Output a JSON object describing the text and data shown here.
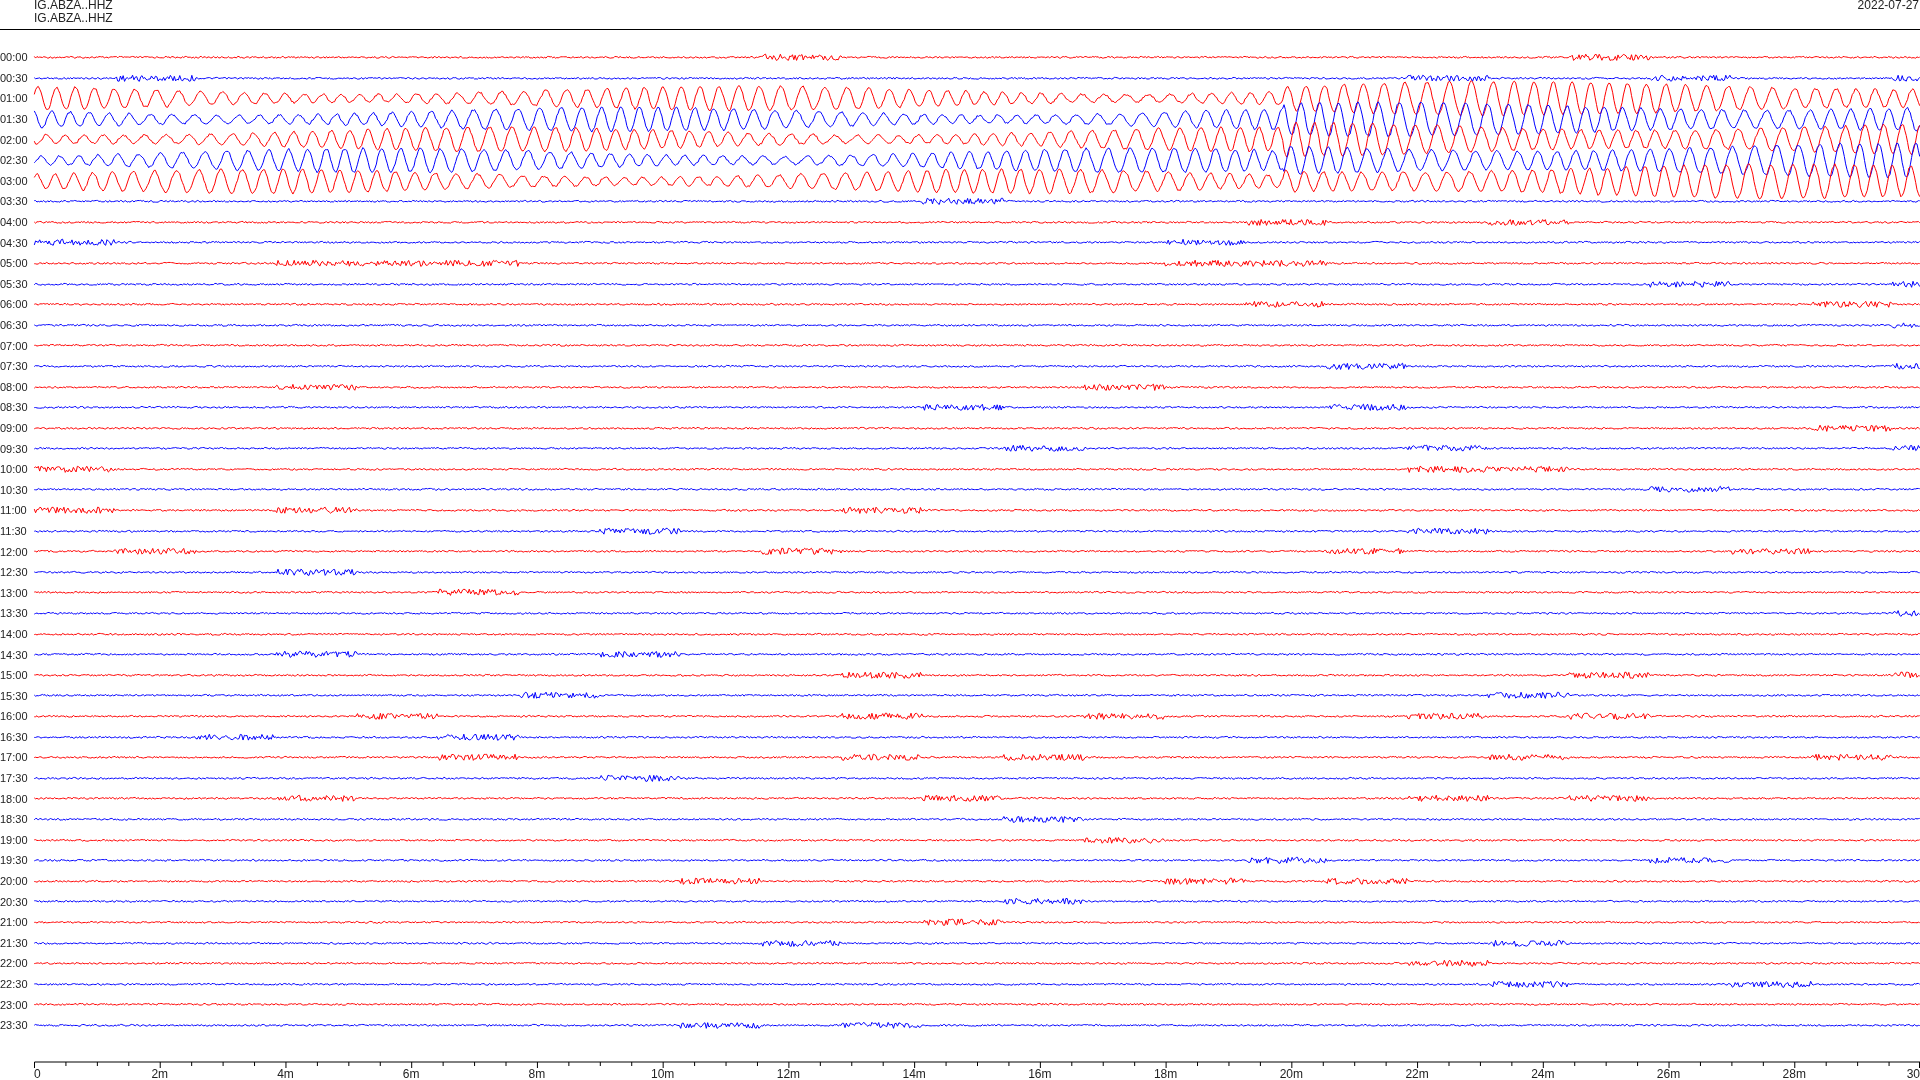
{
  "header": {
    "station_lines": [
      "IG.ABZA..HHZ",
      "IG.ABZA..HHZ"
    ],
    "date": "2022-07-27"
  },
  "rows": [
    {
      "label": "00:00",
      "color": "#ff0000",
      "kind": "quiet"
    },
    {
      "label": "00:30",
      "color": "#0000ff",
      "kind": "quiet"
    },
    {
      "label": "01:00",
      "color": "#ff0000",
      "kind": "strong"
    },
    {
      "label": "01:30",
      "color": "#0000ff",
      "kind": "strong"
    },
    {
      "label": "02:00",
      "color": "#ff0000",
      "kind": "strong"
    },
    {
      "label": "02:30",
      "color": "#0000ff",
      "kind": "strong"
    },
    {
      "label": "03:00",
      "color": "#ff0000",
      "kind": "strong"
    },
    {
      "label": "03:30",
      "color": "#0000ff",
      "kind": "quiet"
    },
    {
      "label": "04:00",
      "color": "#ff0000",
      "kind": "quiet"
    },
    {
      "label": "04:30",
      "color": "#0000ff",
      "kind": "quiet"
    },
    {
      "label": "05:00",
      "color": "#ff0000",
      "kind": "quiet"
    },
    {
      "label": "05:30",
      "color": "#0000ff",
      "kind": "quiet"
    },
    {
      "label": "06:00",
      "color": "#ff0000",
      "kind": "quiet"
    },
    {
      "label": "06:30",
      "color": "#0000ff",
      "kind": "quiet"
    },
    {
      "label": "07:00",
      "color": "#ff0000",
      "kind": "quiet"
    },
    {
      "label": "07:30",
      "color": "#0000ff",
      "kind": "quiet"
    },
    {
      "label": "08:00",
      "color": "#ff0000",
      "kind": "quiet"
    },
    {
      "label": "08:30",
      "color": "#0000ff",
      "kind": "quiet"
    },
    {
      "label": "09:00",
      "color": "#ff0000",
      "kind": "quiet"
    },
    {
      "label": "09:30",
      "color": "#0000ff",
      "kind": "quiet"
    },
    {
      "label": "10:00",
      "color": "#ff0000",
      "kind": "quiet"
    },
    {
      "label": "10:30",
      "color": "#0000ff",
      "kind": "quiet"
    },
    {
      "label": "11:00",
      "color": "#ff0000",
      "kind": "quiet"
    },
    {
      "label": "11:30",
      "color": "#0000ff",
      "kind": "quiet"
    },
    {
      "label": "12:00",
      "color": "#ff0000",
      "kind": "quiet"
    },
    {
      "label": "12:30",
      "color": "#0000ff",
      "kind": "quiet"
    },
    {
      "label": "13:00",
      "color": "#ff0000",
      "kind": "quiet"
    },
    {
      "label": "13:30",
      "color": "#0000ff",
      "kind": "quiet"
    },
    {
      "label": "14:00",
      "color": "#ff0000",
      "kind": "quiet"
    },
    {
      "label": "14:30",
      "color": "#0000ff",
      "kind": "quiet"
    },
    {
      "label": "15:00",
      "color": "#ff0000",
      "kind": "quiet"
    },
    {
      "label": "15:30",
      "color": "#0000ff",
      "kind": "quiet"
    },
    {
      "label": "16:00",
      "color": "#ff0000",
      "kind": "quiet"
    },
    {
      "label": "16:30",
      "color": "#0000ff",
      "kind": "quiet"
    },
    {
      "label": "17:00",
      "color": "#ff0000",
      "kind": "quiet"
    },
    {
      "label": "17:30",
      "color": "#0000ff",
      "kind": "quiet"
    },
    {
      "label": "18:00",
      "color": "#ff0000",
      "kind": "quiet"
    },
    {
      "label": "18:30",
      "color": "#0000ff",
      "kind": "quiet"
    },
    {
      "label": "19:00",
      "color": "#ff0000",
      "kind": "quiet"
    },
    {
      "label": "19:30",
      "color": "#0000ff",
      "kind": "quiet"
    },
    {
      "label": "20:00",
      "color": "#ff0000",
      "kind": "quiet"
    },
    {
      "label": "20:30",
      "color": "#0000ff",
      "kind": "quiet"
    },
    {
      "label": "21:00",
      "color": "#ff0000",
      "kind": "quiet"
    },
    {
      "label": "21:30",
      "color": "#0000ff",
      "kind": "quiet"
    },
    {
      "label": "22:00",
      "color": "#ff0000",
      "kind": "quiet"
    },
    {
      "label": "22:30",
      "color": "#0000ff",
      "kind": "quiet"
    },
    {
      "label": "23:00",
      "color": "#ff0000",
      "kind": "quiet"
    },
    {
      "label": "23:30",
      "color": "#0000ff",
      "kind": "quiet"
    }
  ],
  "time_axis": {
    "tick_labels": [
      "0",
      "2m",
      "4m",
      "6m",
      "8m",
      "10m",
      "12m",
      "14m",
      "16m",
      "18m",
      "20m",
      "22m",
      "24m",
      "26m",
      "28m",
      "30"
    ]
  }
}
